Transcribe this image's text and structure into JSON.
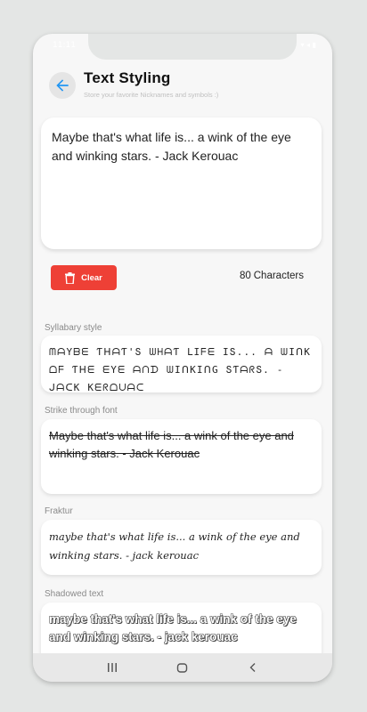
{
  "status": {
    "time": "11:11",
    "icons": "▾ ◂ ▮"
  },
  "header": {
    "title": "Text Styling",
    "subtitle": "Store your favorite Nicknames and symbols :)"
  },
  "editor": {
    "value": "Maybe that's what life is... a wink of the eye and winking stars. - Jack Kerouac"
  },
  "actions": {
    "clear_label": "Clear",
    "char_count": "80",
    "char_label": "Characters"
  },
  "styles": [
    {
      "label": "Syllabary style",
      "text": "ᗰᗩYᗷᗴ ƬᕼᗩƬ'Տ ᗯᕼᗩƬ ᒪIᖴᗴ IՏ... ᗩ ᗯIᑎK ᗝᖴ Ƭᕼᗴ ᗴYᗴ ᗩᑎᗪ ᗯIᑎKIᑎG ՏƬᗩᖇՏ. - ᒍᗩᑕK Kᗴᖇᗝᑌᗩᑕ"
    },
    {
      "label": "Strike through font",
      "text": "Maybe that's what life is... a wink of the eye and winking stars. - Jack Kerouac"
    },
    {
      "label": "Fraktur",
      "text": "maybe that's what life is... a wink of the eye and winking stars. - jack kerouac"
    },
    {
      "label": "Shadowed text",
      "text": "maybe that's what life is... a wink of the eye and winking stars. - jack kerouac"
    }
  ],
  "colors": {
    "accent": "#2196f3",
    "danger": "#ee4036",
    "background": "#f7f7f7"
  },
  "icons": {
    "back": "arrow-left-icon",
    "clear": "trash-icon",
    "nav": [
      "recents-icon",
      "home-icon",
      "back-nav-icon"
    ]
  }
}
